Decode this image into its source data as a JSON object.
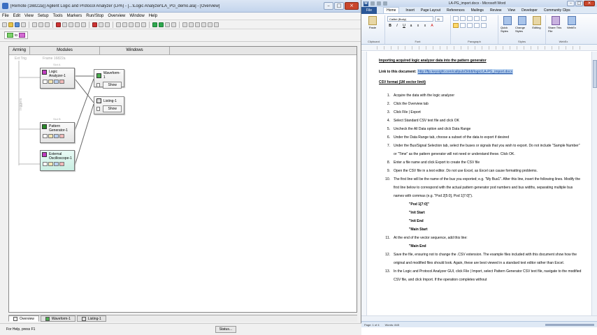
{
  "la": {
    "title": "[Remote (16822a)] Agilent Logic and Protocol Analyzer (LPA) - [...\\Logic Analyzer\\LA_PG_demo.ala] - [Overview]",
    "menu": [
      "File",
      "Edit",
      "View",
      "Setup",
      "Tools",
      "Markers",
      "Run/Stop",
      "Overview",
      "Window",
      "Help"
    ],
    "run_chip_label": "to",
    "headers": {
      "arming": "Arming",
      "modules": "Modules",
      "windows": "Windows"
    },
    "ext_trig": "Ext Trig",
    "frame": "Frame 16822a",
    "triggers": "Triggers",
    "slot_a": "Slot A",
    "slot_b": "Slot B",
    "modules": [
      {
        "name": "Logic Analyzer-1",
        "icon_color": "#c03cc0"
      },
      {
        "name": "Pattern Generator-1",
        "icon_color": "#2a8a2a"
      },
      {
        "name": "External Oscilloscope-1",
        "icon_color": "#c03cc0"
      }
    ],
    "windows": [
      {
        "name": "Waveform-1",
        "show": "Show"
      },
      {
        "name": "Listing-1",
        "show": "Show"
      }
    ],
    "tabs": [
      "Overview",
      "Waveform-1",
      "Listing-1"
    ],
    "status_left": "For Help, press F1",
    "status_btn": "Status..."
  },
  "word": {
    "title": "LA-PG_import.docx - Microsoft Word",
    "tabs": [
      "File",
      "Home",
      "Insert",
      "Page Layout",
      "References",
      "Mailings",
      "Review",
      "View",
      "Developer",
      "Community Clips"
    ],
    "ribbon": {
      "paste": "Paste",
      "font": "Calibri (Body)",
      "size": "11",
      "quick_styles": "Quick Styles",
      "change_styles": "Change Styles",
      "editing": "Editing",
      "share": "Share This File",
      "webex": "WebEx",
      "groups": [
        "Clipboard",
        "Font",
        "Paragraph",
        "Styles",
        "WebEx"
      ]
    },
    "doc": {
      "heading": "Importing acquired logic analyzer data into the pattern generator",
      "link_label": "Link to this document:",
      "link_url": "http://ftp.keysight.com/callpub/3/ddt/logic/LA-PG_import.docx",
      "csv_heading": "CSV format (1M vector limit)",
      "steps": [
        {
          "n": "1.",
          "t": "Acquire the data with the logic analyzer"
        },
        {
          "n": "2.",
          "t": "Click the Overview tab"
        },
        {
          "n": "3.",
          "t": "Click File | Export"
        },
        {
          "n": "4.",
          "t": "Select Standard CSV text file and click OK"
        },
        {
          "n": "5.",
          "t": "Uncheck the All Data option and click Data Range"
        },
        {
          "n": "6.",
          "t": "Under the Data Range tab, choose a subset of the data to export if desired"
        },
        {
          "n": "7.",
          "t": "Under the Bus/Signal Selection tab, select the buses or signals that you wish to export.  Do not include \"Sample Number\" or \"Time\" as the pattern generator will not need or understand these.  Click OK."
        },
        {
          "n": "8.",
          "t": "Enter a file name and click Export to create the CSV file"
        },
        {
          "n": "9.",
          "t": "Open the CSV file in a text editor.  Do not use Excel, as Excel can cause formatting problems."
        },
        {
          "n": "10.",
          "t": "The first line will be the name of the bus you exported; e.g. \"My Bus1\".  After this line, insert the following lines.  Modify the first line below to correspond with the actual pattern generator pod numbers and bus widths, separating multiple bus names with commas (e.g. \"Pod 2[5:0], Pod 1[7:0]\")."
        }
      ],
      "sub_lines": [
        "\"Pod 1[7:0]\"",
        "\"Init Start",
        "\"Init End",
        "\"Main Start"
      ],
      "step11": {
        "n": "11.",
        "t": "At the end of the vector sequence, add this line:"
      },
      "sub_line2": "\"Main End",
      "step12": {
        "n": "12.",
        "t": "Save the file, ensuring not to change the .CSV extension.  The example files included with this document show how the original and modified files should look.  Again, these are best viewed in a standard text editor rather than Excel."
      },
      "step13": {
        "n": "13.",
        "t": "In the Logic and Protocol Analyzer GUI, click File | Import, select Pattern Generator CSV text file, navigate to the modified CSV file, and click Import.  If the operation completes without"
      }
    },
    "status": {
      "page": "Page: 1 of 4",
      "words": "Words: 845"
    }
  }
}
